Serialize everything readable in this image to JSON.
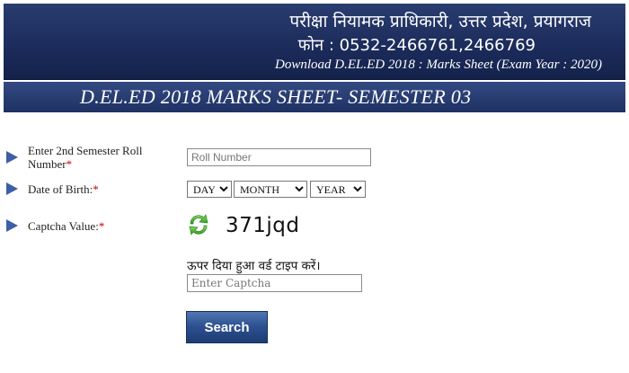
{
  "header": {
    "line1": "परीक्षा नियामक प्राधिकारी, उत्तर प्रदेश, प्रयागराज",
    "line2": "फोन : 0532-2466761,2466769",
    "line3": "Download D.EL.ED 2018 : Marks Sheet (Exam Year : 2020)"
  },
  "title": "D.EL.ED 2018 MARKS SHEET- SEMESTER 03",
  "form": {
    "roll": {
      "label_line1": "Enter 2nd Semester Roll",
      "label_line2": "Number",
      "required": "*",
      "placeholder": "Roll Number",
      "value": ""
    },
    "dob": {
      "label": "Date of Birth:",
      "required": "*",
      "day": "DAY",
      "month": "MONTH",
      "year": "YEAR"
    },
    "captcha": {
      "label": "Captcha Value:",
      "required": "*",
      "value": "371jqd",
      "refresh_icon": "refresh-icon",
      "hint": "ऊपर दिया हुआ वर्ड टाइप करें।",
      "placeholder": "Enter Captcha",
      "input_value": ""
    },
    "submit_label": "Search"
  },
  "colors": {
    "header_bg": "#1c2c5c",
    "arrow": "#3d5fa8",
    "required": "#cc0000",
    "button": "#2c4f8e"
  }
}
